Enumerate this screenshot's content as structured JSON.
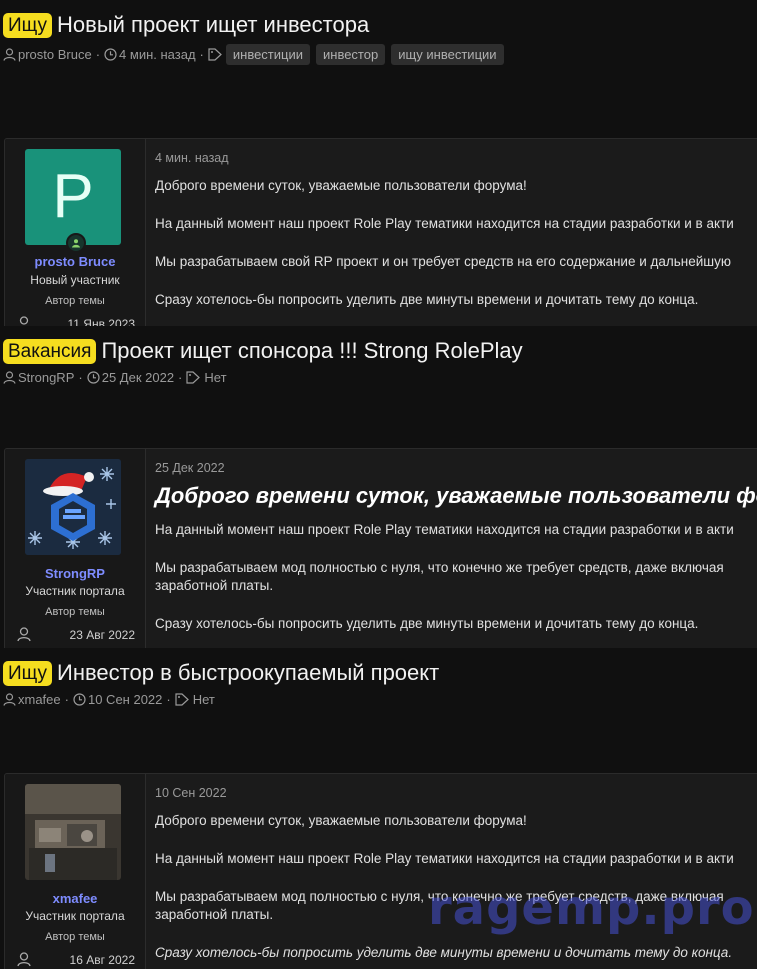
{
  "threads": [
    {
      "label": "Ищу",
      "title": "Новый проект ищет инвестора",
      "author": "prosto Bruce",
      "time": "4 мин. назад",
      "tags": [
        "инвестиции",
        "инвестор",
        "ищу инвестиции"
      ],
      "post": {
        "username": "prosto Bruce",
        "user_title": "Новый участник",
        "author_badge": "Автор темы",
        "registered": "11 Янв 2023",
        "avatar_letter": "P",
        "date": "4 мин. назад",
        "paragraphs": [
          "Доброго времени суток, уважаемые пользователи форума!",
          "На данный момент наш проект Role Play тематики находится на стадии разработки и в акти",
          "Мы разрабатываем свой RP проект и он требует средств на его содержание и дальнейшую",
          "Сразу хотелось-бы попросить уделить две минуты времени и дочитать тему до конца."
        ]
      }
    },
    {
      "label": "Вакансия",
      "title": "Проект ищет спонсора !!! Strong RolePlay",
      "author": "StrongRP",
      "time": "25 Дек 2022",
      "tags_text": "Нет",
      "post": {
        "username": "StrongRP",
        "user_title": "Участник портала",
        "author_badge": "Автор темы",
        "registered": "23 Авг 2022",
        "date": "25 Дек 2022",
        "heading": "Доброго времени суток, уважаемые пользователи форум",
        "paragraphs": [
          "На данный момент наш проект Role Play тематики находится на стадии разработки и в акти",
          "Мы разрабатываем мод полностью с нуля, что конечно же требует средств, даже включая заработной платы.",
          "Сразу хотелось-бы попросить уделить две минуты времени и дочитать тему до конца."
        ]
      }
    },
    {
      "label": "Ищу",
      "title": "Инвестор в быстроокупаемый проект",
      "author": "xmafee",
      "time": "10 Сен 2022",
      "tags_text": "Нет",
      "post": {
        "username": "xmafee",
        "user_title": "Участник портала",
        "author_badge": "Автор темы",
        "registered": "16 Авг 2022",
        "date": "10 Сен 2022",
        "paragraphs": [
          "Доброго времени суток, уважаемые пользователи форума!",
          "На данный момент наш проект Role Play тематики находится на стадии разработки и в акти",
          "Мы разрабатываем мод полностью с нуля, что конечно же требует средств, даже включая заработной платы.",
          "Сразу хотелось-бы попросить уделить две минуты времени и дочитать тему до конца."
        ]
      }
    }
  ],
  "watermark": "ragemp.pro",
  "colors": {
    "label_bg": "#f5dd1f",
    "username": "#7e8cff",
    "avatar_bg": "#19927a"
  },
  "icons": [
    "user-icon",
    "clock-icon",
    "tag-icon",
    "online-icon"
  ]
}
